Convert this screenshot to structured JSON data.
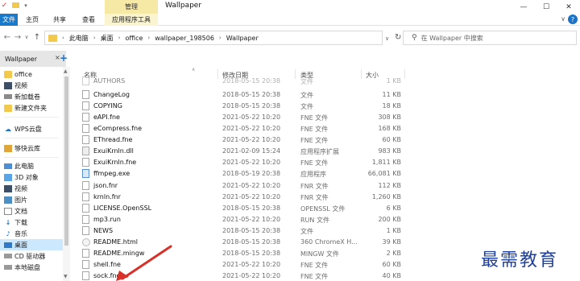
{
  "titlebar": {
    "context_tab": "管理",
    "title": "Wallpaper",
    "controls": [
      "—",
      "☐",
      "✕"
    ]
  },
  "ribbon": {
    "tabs": [
      "文件",
      "主页",
      "共享",
      "查看",
      "应用程序工具"
    ]
  },
  "address": {
    "crumbs": [
      "此电脑",
      "桌面",
      "office",
      "wallpaper_198506",
      "Wallpaper"
    ],
    "search_placeholder": "在 Wallpaper 中搜索"
  },
  "tab": {
    "label": "Wallpaper",
    "close": "×",
    "add": "+"
  },
  "sidebar": {
    "items": [
      {
        "label": "office",
        "icon": "folder-icon"
      },
      {
        "label": "视频",
        "icon": "video-folder-icon"
      },
      {
        "label": "新加载卷",
        "icon": "drive-icon"
      },
      {
        "label": "新建文件夹",
        "icon": "folder-icon"
      },
      {
        "label": "WPS云盘",
        "icon": "cloud-icon"
      },
      {
        "label": "够快云库",
        "icon": "cloud-folder-icon"
      },
      {
        "label": "此电脑",
        "icon": "computer-icon"
      },
      {
        "label": "3D 对象",
        "icon": "3d-objects-icon"
      },
      {
        "label": "视频",
        "icon": "video-icon"
      },
      {
        "label": "图片",
        "icon": "pictures-icon"
      },
      {
        "label": "文档",
        "icon": "documents-icon"
      },
      {
        "label": "下载",
        "icon": "download-icon"
      },
      {
        "label": "音乐",
        "icon": "music-icon"
      },
      {
        "label": "桌面",
        "icon": "desktop-icon"
      },
      {
        "label": "CD 驱动器",
        "icon": "cd-drive-icon"
      },
      {
        "label": "本地磁盘",
        "icon": "disk-icon"
      }
    ],
    "selected": "桌面"
  },
  "columns": {
    "name": "名称",
    "date": "修改日期",
    "type": "类型",
    "size": "大小"
  },
  "files": [
    {
      "name": "AUTHORS",
      "date": "2018-05-15 20:38",
      "type": "文件",
      "size": "1 KB",
      "icon": "file"
    },
    {
      "name": "ChangeLog",
      "date": "2018-05-15 20:38",
      "type": "文件",
      "size": "11 KB",
      "icon": "file"
    },
    {
      "name": "COPYING",
      "date": "2018-05-15 20:38",
      "type": "文件",
      "size": "18 KB",
      "icon": "file"
    },
    {
      "name": "eAPI.fne",
      "date": "2021-05-22 10:20",
      "type": "FNE 文件",
      "size": "308 KB",
      "icon": "file"
    },
    {
      "name": "eCompress.fne",
      "date": "2021-05-22 10:20",
      "type": "FNE 文件",
      "size": "168 KB",
      "icon": "file"
    },
    {
      "name": "EThread.fne",
      "date": "2021-05-22 10:20",
      "type": "FNE 文件",
      "size": "60 KB",
      "icon": "file"
    },
    {
      "name": "ExuiKrnln.dll",
      "date": "2021-02-09 15:24",
      "type": "应用程序扩展",
      "size": "983 KB",
      "icon": "dll"
    },
    {
      "name": "ExuiKrnln.fne",
      "date": "2021-05-22 10:20",
      "type": "FNE 文件",
      "size": "1,811 KB",
      "icon": "file"
    },
    {
      "name": "ffmpeg.exe",
      "date": "2018-05-19 20:38",
      "type": "应用程序",
      "size": "66,081 KB",
      "icon": "exe"
    },
    {
      "name": "json.fnr",
      "date": "2021-05-22 10:20",
      "type": "FNR 文件",
      "size": "112 KB",
      "icon": "file"
    },
    {
      "name": "krnln.fnr",
      "date": "2021-05-22 10:20",
      "type": "FNR 文件",
      "size": "1,260 KB",
      "icon": "file"
    },
    {
      "name": "LICENSE.OpenSSL",
      "date": "2018-05-15 20:38",
      "type": "OPENSSL 文件",
      "size": "6 KB",
      "icon": "file"
    },
    {
      "name": "mp3.run",
      "date": "2021-05-22 10:20",
      "type": "RUN 文件",
      "size": "200 KB",
      "icon": "file"
    },
    {
      "name": "NEWS",
      "date": "2018-05-15 20:38",
      "type": "文件",
      "size": "1 KB",
      "icon": "file"
    },
    {
      "name": "README.html",
      "date": "2018-05-15 20:38",
      "type": "360 ChromeX H...",
      "size": "39 KB",
      "icon": "html"
    },
    {
      "name": "README.mingw",
      "date": "2018-05-15 20:38",
      "type": "MINGW 文件",
      "size": "2 KB",
      "icon": "file"
    },
    {
      "name": "shell.fne",
      "date": "2021-05-22 10:20",
      "type": "FNE 文件",
      "size": "60 KB",
      "icon": "file"
    },
    {
      "name": "sock.fne",
      "date": "2021-05-22 10:20",
      "type": "FNE 文件",
      "size": "40 KB",
      "icon": "file"
    }
  ],
  "watermark": "最需教育",
  "colors": {
    "accent": "#1979ca",
    "context_tab": "#f6e9a6",
    "selection": "#cce8ff",
    "arrow": "#d9302a",
    "watermark": "#1f3f9a"
  }
}
